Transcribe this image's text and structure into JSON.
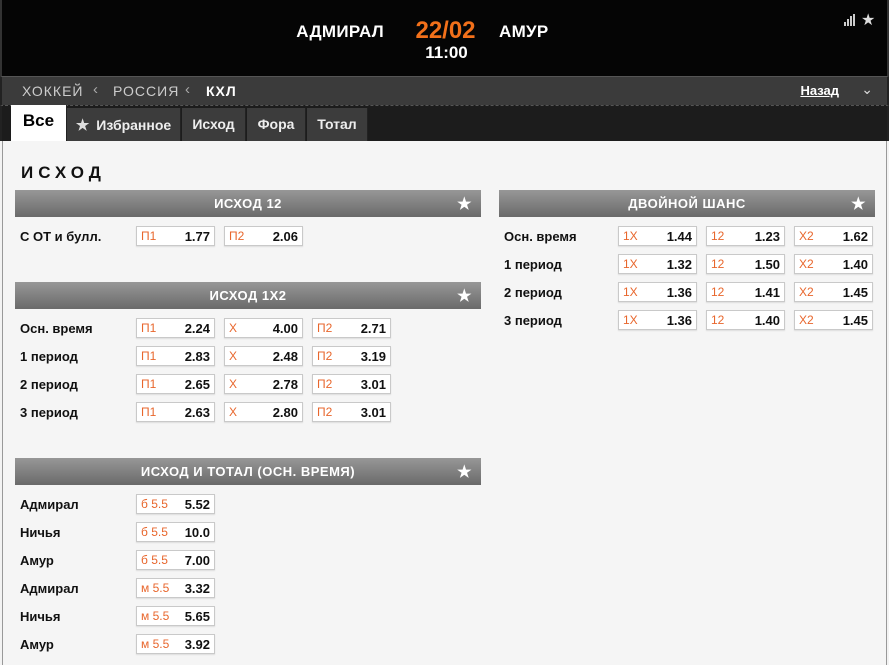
{
  "match": {
    "home_team": "АДМИРАЛ",
    "away_team": "АМУР",
    "date": "22/02",
    "time": "11:00"
  },
  "header_icons": [
    "stats-icon",
    "star-icon"
  ],
  "breadcrumb": {
    "items": [
      "ХОККЕЙ",
      "РОССИЯ",
      "КХЛ"
    ],
    "back_label": "Назад"
  },
  "tabs": [
    {
      "label": "Все",
      "active": true
    },
    {
      "label": "Избранное",
      "icon": "star-icon"
    },
    {
      "label": "Исход"
    },
    {
      "label": "Фора"
    },
    {
      "label": "Тотал"
    }
  ],
  "section_title": "ИСХОД",
  "colors": {
    "accent": "#f2701a",
    "odd_key": "#e8662c",
    "market_header": "#808080"
  },
  "markets": {
    "outcome12": {
      "title": "ИСХОД 12",
      "rows": [
        {
          "label": "С ОТ и булл.",
          "odds": [
            {
              "k": "П1",
              "v": "1.77"
            },
            {
              "k": "П2",
              "v": "2.06"
            }
          ]
        }
      ]
    },
    "outcome1x2": {
      "title": "ИСХОД 1Х2",
      "rows": [
        {
          "label": "Осн. время",
          "odds": [
            {
              "k": "П1",
              "v": "2.24"
            },
            {
              "k": "Х",
              "v": "4.00"
            },
            {
              "k": "П2",
              "v": "2.71"
            }
          ]
        },
        {
          "label": "1 период",
          "odds": [
            {
              "k": "П1",
              "v": "2.83"
            },
            {
              "k": "Х",
              "v": "2.48"
            },
            {
              "k": "П2",
              "v": "3.19"
            }
          ]
        },
        {
          "label": "2 период",
          "odds": [
            {
              "k": "П1",
              "v": "2.65"
            },
            {
              "k": "Х",
              "v": "2.78"
            },
            {
              "k": "П2",
              "v": "3.01"
            }
          ]
        },
        {
          "label": "3 период",
          "odds": [
            {
              "k": "П1",
              "v": "2.63"
            },
            {
              "k": "Х",
              "v": "2.80"
            },
            {
              "k": "П2",
              "v": "3.01"
            }
          ]
        }
      ]
    },
    "outcome_total": {
      "title": "ИСХОД И ТОТАЛ (ОСН. ВРЕМЯ)",
      "rows": [
        {
          "label": "Адмирал",
          "odds": [
            {
              "k": "б 5.5",
              "v": "5.52"
            }
          ]
        },
        {
          "label": "Ничья",
          "odds": [
            {
              "k": "б 5.5",
              "v": "10.0"
            }
          ]
        },
        {
          "label": "Амур",
          "odds": [
            {
              "k": "б 5.5",
              "v": "7.00"
            }
          ]
        },
        {
          "label": "Адмирал",
          "odds": [
            {
              "k": "м 5.5",
              "v": "3.32"
            }
          ]
        },
        {
          "label": "Ничья",
          "odds": [
            {
              "k": "м 5.5",
              "v": "5.65"
            }
          ]
        },
        {
          "label": "Амур",
          "odds": [
            {
              "k": "м 5.5",
              "v": "3.92"
            }
          ]
        }
      ]
    },
    "double_chance": {
      "title": "ДВОЙНОЙ ШАНС",
      "rows": [
        {
          "label": "Осн. время",
          "odds": [
            {
              "k": "1Х",
              "v": "1.44"
            },
            {
              "k": "12",
              "v": "1.23"
            },
            {
              "k": "Х2",
              "v": "1.62"
            }
          ]
        },
        {
          "label": "1 период",
          "odds": [
            {
              "k": "1Х",
              "v": "1.32"
            },
            {
              "k": "12",
              "v": "1.50"
            },
            {
              "k": "Х2",
              "v": "1.40"
            }
          ]
        },
        {
          "label": "2 период",
          "odds": [
            {
              "k": "1Х",
              "v": "1.36"
            },
            {
              "k": "12",
              "v": "1.41"
            },
            {
              "k": "Х2",
              "v": "1.45"
            }
          ]
        },
        {
          "label": "3 период",
          "odds": [
            {
              "k": "1Х",
              "v": "1.36"
            },
            {
              "k": "12",
              "v": "1.40"
            },
            {
              "k": "Х2",
              "v": "1.45"
            }
          ]
        }
      ]
    }
  }
}
